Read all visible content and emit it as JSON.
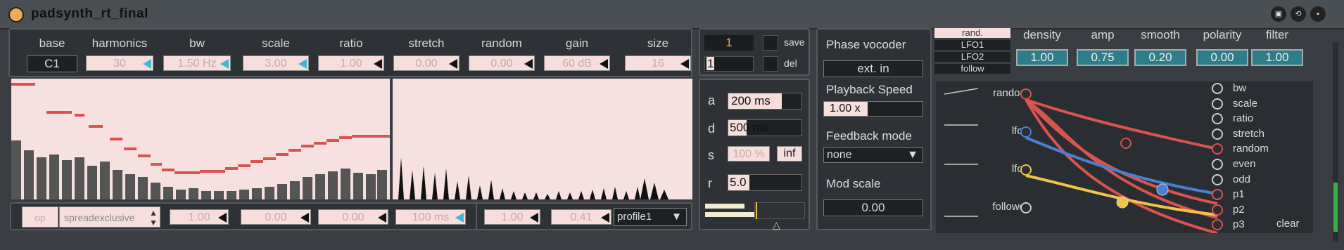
{
  "title": "padsynth_rt_final",
  "params": {
    "labels": [
      "base",
      "harmonics",
      "bw",
      "scale",
      "ratio",
      "stretch",
      "random",
      "gain",
      "size"
    ],
    "values": [
      "C1",
      "30",
      "1.50 Hz",
      "3.00",
      "1.00",
      "0.00",
      "0.00",
      "60 dB",
      "16"
    ]
  },
  "bottom_left": {
    "op": "op",
    "mode": "spreadexclusive",
    "v1": "1.00",
    "v2": "0.00",
    "v3": "0.00",
    "v4": "100 ms"
  },
  "bottom_mid": {
    "v1": "1.00",
    "v2": "0.41",
    "profile": "profile1"
  },
  "preset": {
    "num": "1",
    "num2": "1",
    "save": "save",
    "del": "del"
  },
  "env": {
    "a_label": "a",
    "a": "200 ms",
    "d_label": "d",
    "d": "500 ms",
    "s_label": "s",
    "s": "100 %",
    "inf": "inf",
    "r_label": "r",
    "r": "5.0"
  },
  "vocoder": {
    "title": "Phase vocoder",
    "ext": "ext. in",
    "speed_label": "Playback Speed",
    "speed": "1.00 x",
    "feedback_label": "Feedback mode",
    "feedback": "none",
    "modscale_label": "Mod scale",
    "modscale": "0.00"
  },
  "mod_tabs": [
    "rand.",
    "LFO1",
    "LFO2",
    "follow"
  ],
  "mod_params": {
    "labels": [
      "density",
      "amp",
      "smooth",
      "polarity",
      "filter"
    ],
    "values": [
      "1.00",
      "0.75",
      "0.20",
      "0.00",
      "1.00"
    ]
  },
  "sources": [
    "random",
    "lfo1",
    "lfo2",
    "follower"
  ],
  "targets": [
    "bw",
    "scale",
    "ratio",
    "stretch",
    "random",
    "even",
    "odd",
    "p1",
    "p2",
    "p3"
  ],
  "clear": "clear",
  "colors": {
    "accent": "#f1a95a",
    "pink": "#f7dedd",
    "red": "#d9534f",
    "blue": "#4a7fd4",
    "yellow": "#f0c34a",
    "teal": "#2e7d8a"
  }
}
